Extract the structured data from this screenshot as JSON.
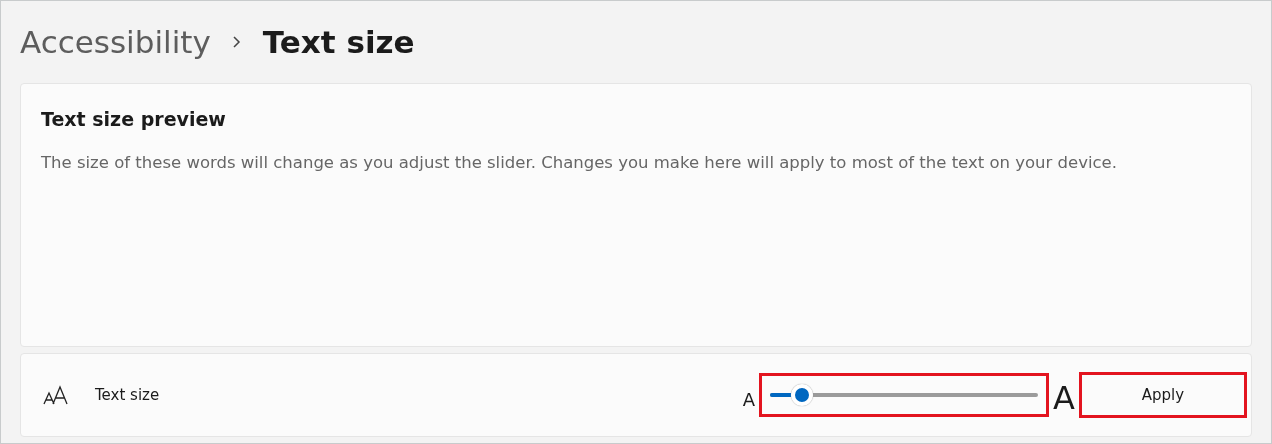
{
  "breadcrumb": {
    "parent": "Accessibility",
    "current": "Text size"
  },
  "preview": {
    "title": "Text size preview",
    "text": "The size of these words will change as you adjust the slider. Changes you make here will apply to most of the text on your device."
  },
  "setting": {
    "label": "Text size",
    "small_label": "A",
    "large_label": "A",
    "slider": {
      "level": 0.12,
      "highlighted": true
    },
    "button": {
      "label": "Apply",
      "highlighted": true
    }
  }
}
